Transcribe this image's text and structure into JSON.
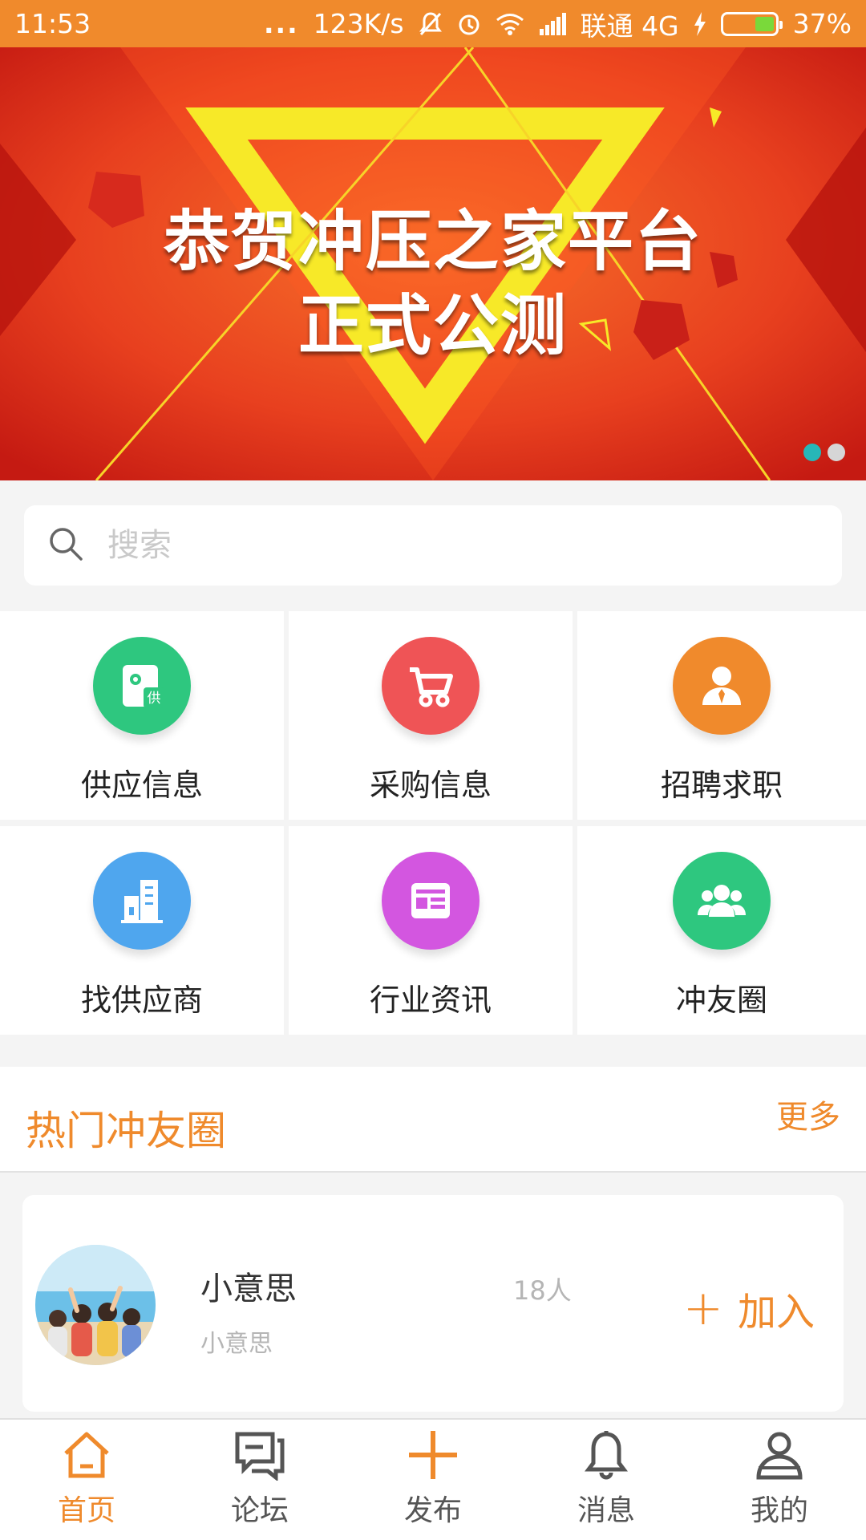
{
  "status_bar": {
    "time": "11:53",
    "dots": "...",
    "speed": "123K/s",
    "carrier": "联通",
    "network": "4G",
    "battery": "37%",
    "battery_level": 0.37,
    "icons": [
      "mute-icon",
      "alarm-icon",
      "wifi-icon",
      "signal-icon",
      "charging-icon",
      "battery-icon"
    ]
  },
  "banner": {
    "line1": "恭贺冲压之家平台",
    "line2": "正式公测",
    "slide_count": 2,
    "active_slide": 1,
    "colors": {
      "background": "#e8401f",
      "accent": "#f7e928"
    }
  },
  "search": {
    "placeholder": "搜索",
    "value": ""
  },
  "grid": {
    "items": [
      {
        "label": "供应信息",
        "icon": "supply-icon",
        "color": "#2ec77f"
      },
      {
        "label": "采购信息",
        "icon": "cart-icon",
        "color": "#ef5456"
      },
      {
        "label": "招聘求职",
        "icon": "recruit-icon",
        "color": "#f08a2c"
      },
      {
        "label": "找供应商",
        "icon": "building-icon",
        "color": "#4fa6ee"
      },
      {
        "label": "行业资讯",
        "icon": "news-icon",
        "color": "#d356e0"
      },
      {
        "label": "冲友圈",
        "icon": "group-icon",
        "color": "#2ec77f"
      }
    ]
  },
  "hot_section": {
    "title": "热门冲友圈",
    "more": "更多"
  },
  "groups": [
    {
      "name": "小意思",
      "description": "小意思",
      "member_count": "18人",
      "join_label": "加入",
      "join_symbol": "+"
    }
  ],
  "bottom_nav": {
    "items": [
      {
        "label": "首页",
        "icon": "home-icon",
        "active": true
      },
      {
        "label": "论坛",
        "icon": "forum-icon",
        "active": false
      },
      {
        "label": "发布",
        "icon": "publish-plus-icon",
        "active": false
      },
      {
        "label": "消息",
        "icon": "bell-icon",
        "active": false
      },
      {
        "label": "我的",
        "icon": "profile-icon",
        "active": false
      }
    ]
  },
  "colors": {
    "primary": "#ef8a2c",
    "status_bar": "#f08a2c"
  }
}
